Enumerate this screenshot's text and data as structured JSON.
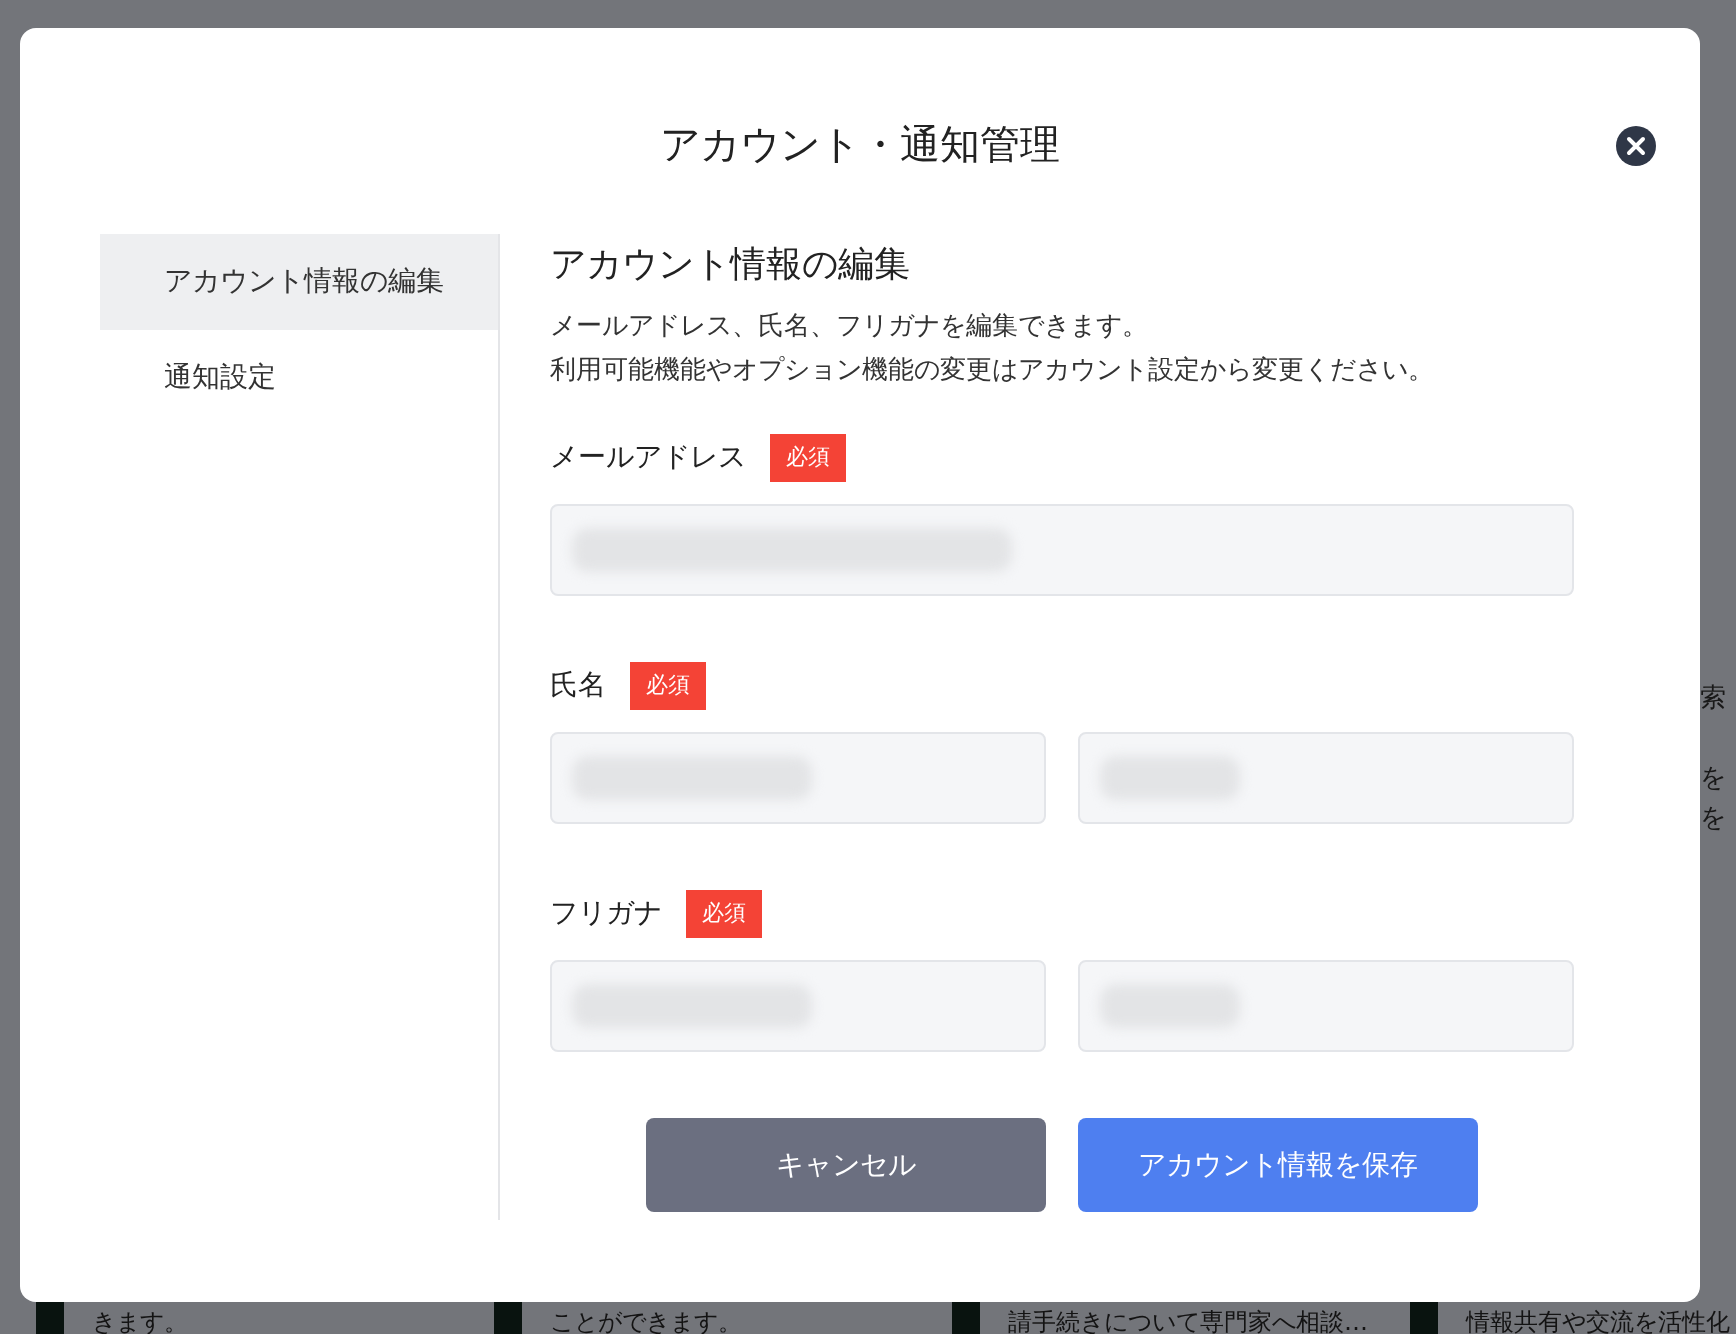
{
  "background": {
    "side_texts": [
      "索",
      "を",
      "を"
    ],
    "card_texts": [
      "きます。",
      "ことができます。",
      "請手続きについて専門家へ相談…",
      "情報共有や交流を活性化"
    ]
  },
  "dialog": {
    "title": "アカウント・通知管理",
    "sidebar": {
      "items": [
        {
          "label": "アカウント情報の編集",
          "selected": true
        },
        {
          "label": "通知設定",
          "selected": false
        }
      ]
    },
    "heading": "アカウント情報の編集",
    "description": [
      "メールアドレス、氏名、フリガナを編集できます。",
      "利用可能機能やオプション機能の変更はアカウント設定から変更ください。"
    ],
    "fields": [
      {
        "label": "メールアドレス",
        "badge": "必須",
        "kind": "single"
      },
      {
        "label": "氏名",
        "badge": "必須",
        "kind": "pair"
      },
      {
        "label": "フリガナ",
        "badge": "必須",
        "kind": "pair"
      }
    ],
    "buttons": [
      {
        "label": "キャンセル",
        "kind": "secondary"
      },
      {
        "label": "アカウント情報を保存",
        "kind": "primary"
      }
    ]
  }
}
